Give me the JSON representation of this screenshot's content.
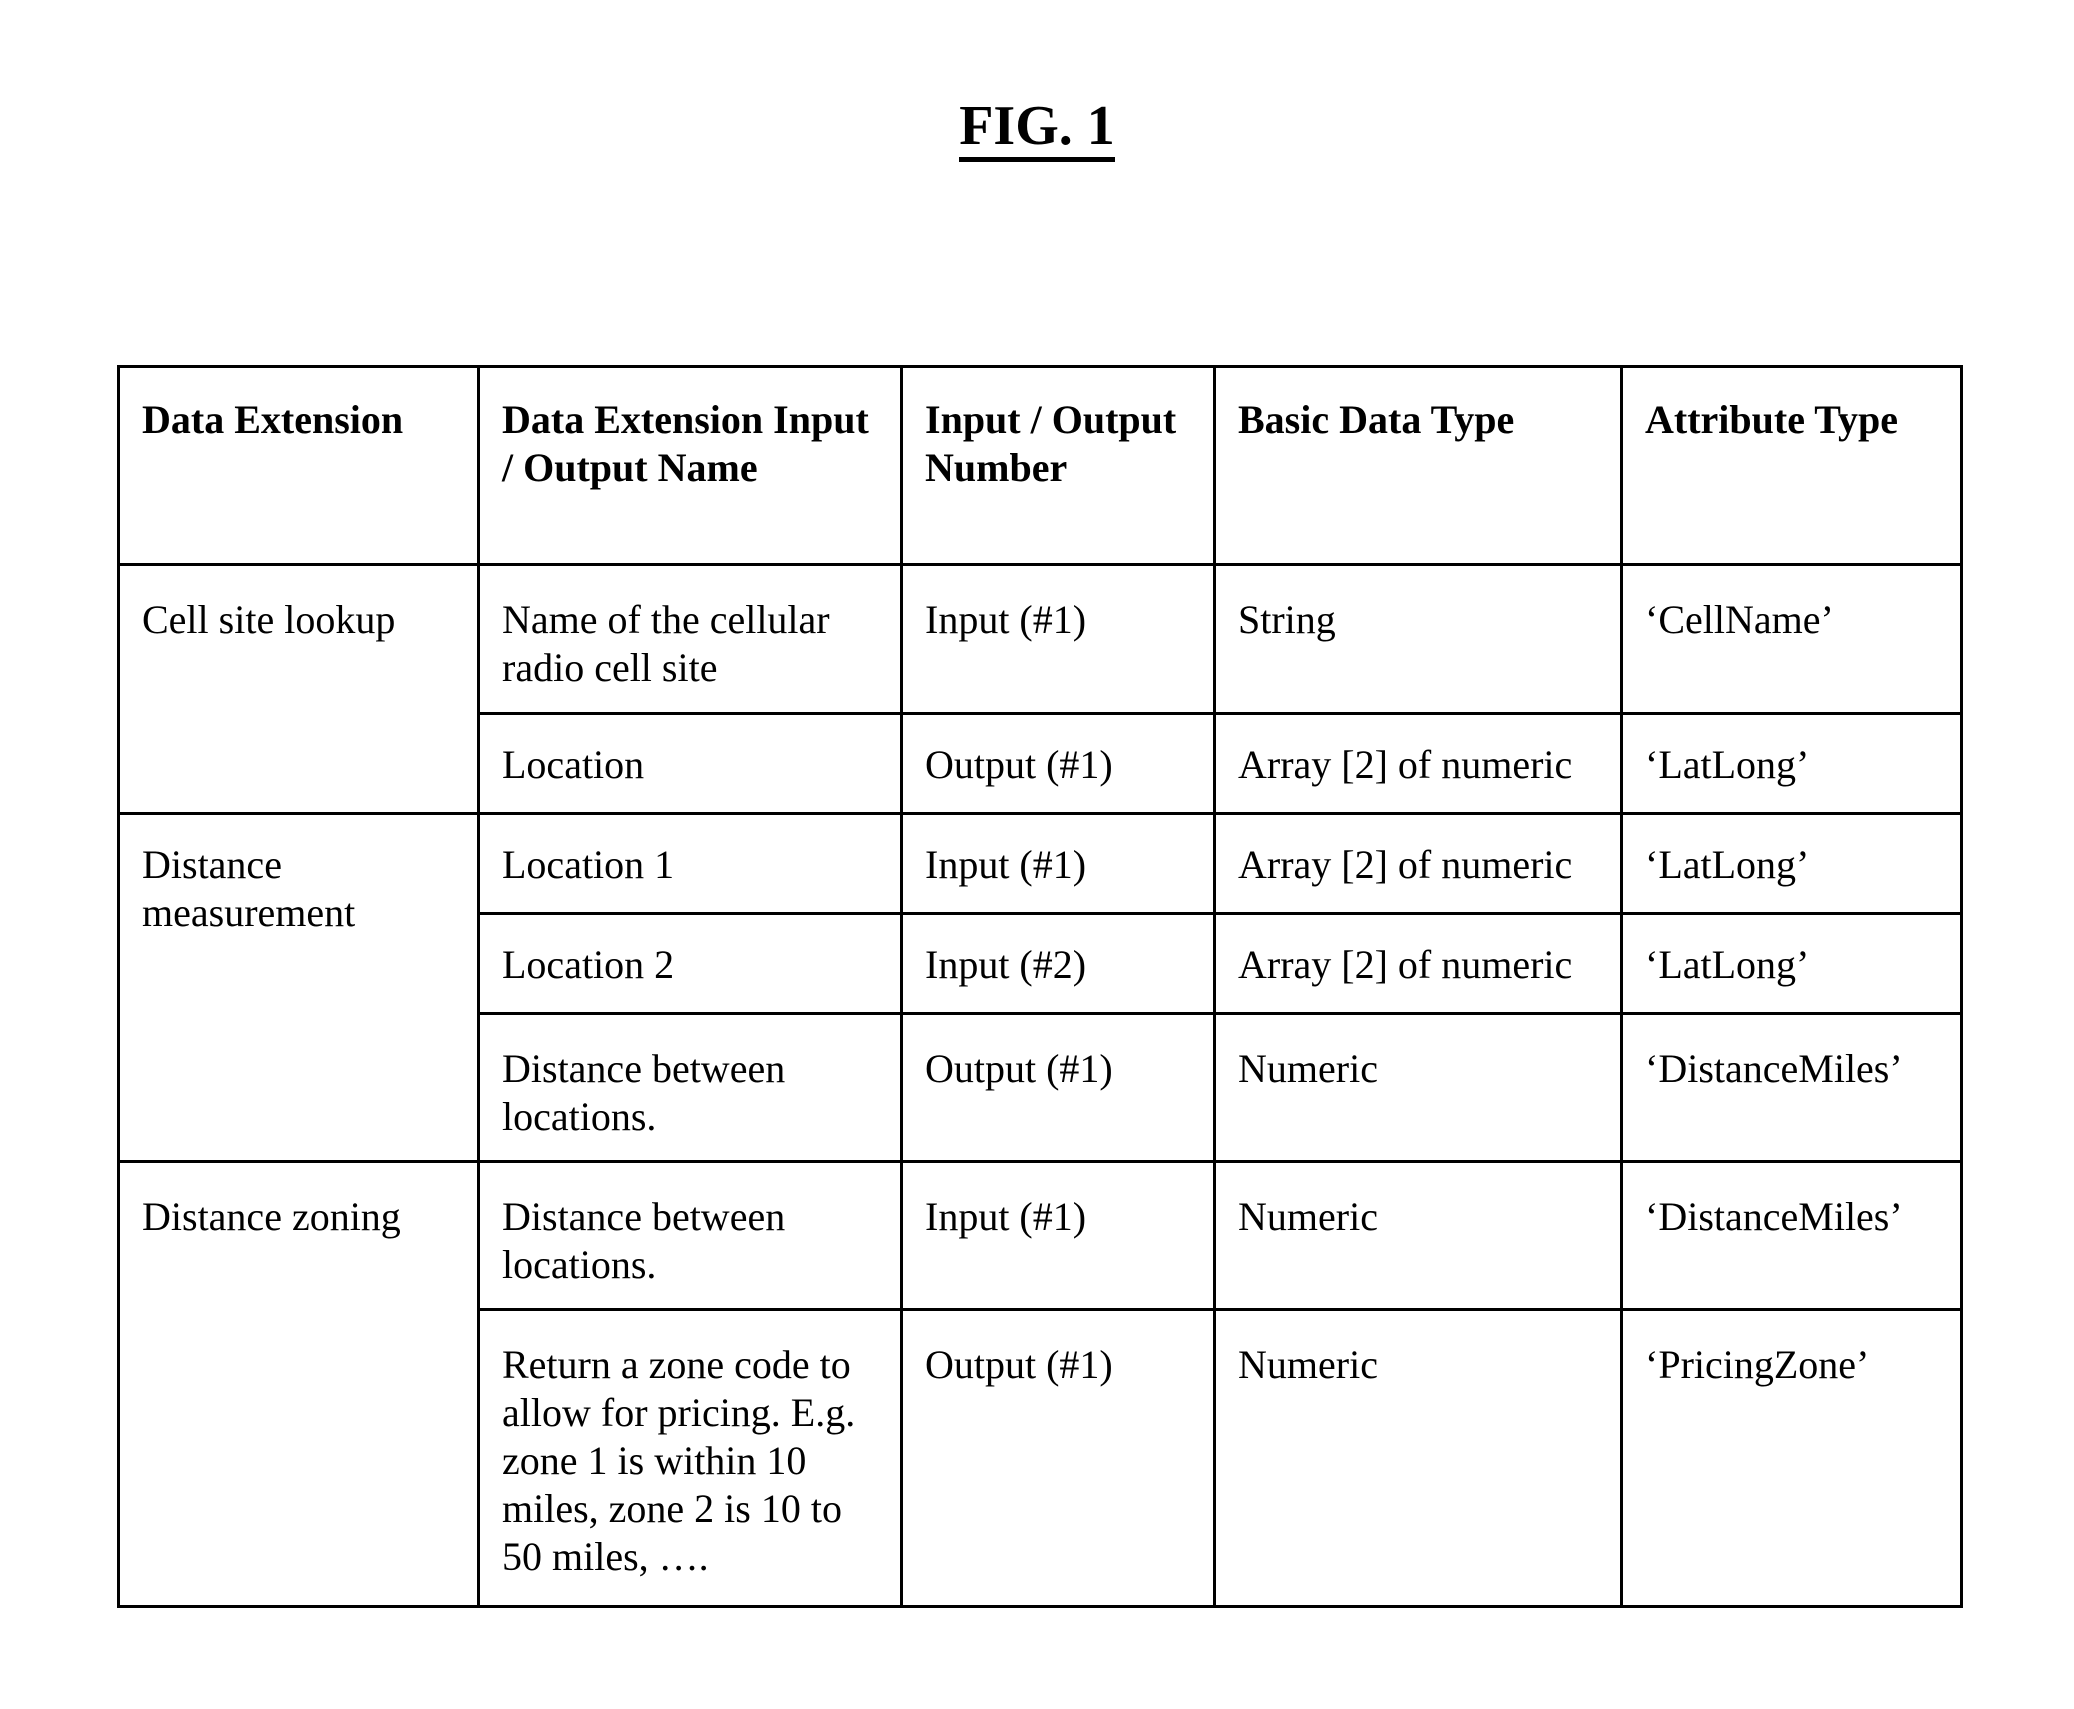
{
  "figure": {
    "title": "FIG. 1"
  },
  "table": {
    "headers": [
      "Data Extension",
      "Data Extension Input / Output Name",
      "Input / Output Number",
      "Basic Data Type",
      "Attribute Type"
    ],
    "groups": [
      {
        "data_extension": "Cell site lookup",
        "rows": [
          {
            "io_name": "Name of the cellular radio cell site",
            "io_number": "Input (#1)",
            "basic_data_type": "String",
            "attribute_type": "‘CellName’"
          },
          {
            "io_name": "Location",
            "io_number": "Output (#1)",
            "basic_data_type": "Array [2] of numeric",
            "attribute_type": "‘LatLong’"
          }
        ]
      },
      {
        "data_extension": "Distance measurement",
        "rows": [
          {
            "io_name": "Location 1",
            "io_number": "Input (#1)",
            "basic_data_type": "Array [2] of numeric",
            "attribute_type": "‘LatLong’"
          },
          {
            "io_name": "Location 2",
            "io_number": "Input (#2)",
            "basic_data_type": "Array [2] of numeric",
            "attribute_type": "‘LatLong’"
          },
          {
            "io_name": "Distance between locations.",
            "io_number": "Output (#1)",
            "basic_data_type": "Numeric",
            "attribute_type": "‘DistanceMiles’"
          }
        ]
      },
      {
        "data_extension": "Distance zoning",
        "rows": [
          {
            "io_name": "Distance between locations.",
            "io_number": "Input (#1)",
            "basic_data_type": "Numeric",
            "attribute_type": "‘DistanceMiles’"
          },
          {
            "io_name": "Return a zone code to allow for pricing. E.g. zone 1 is within 10 miles, zone 2 is 10 to 50 miles, ….",
            "io_number": "Output (#1)",
            "basic_data_type": "Numeric",
            "attribute_type": "‘PricingZone’"
          }
        ]
      }
    ]
  }
}
